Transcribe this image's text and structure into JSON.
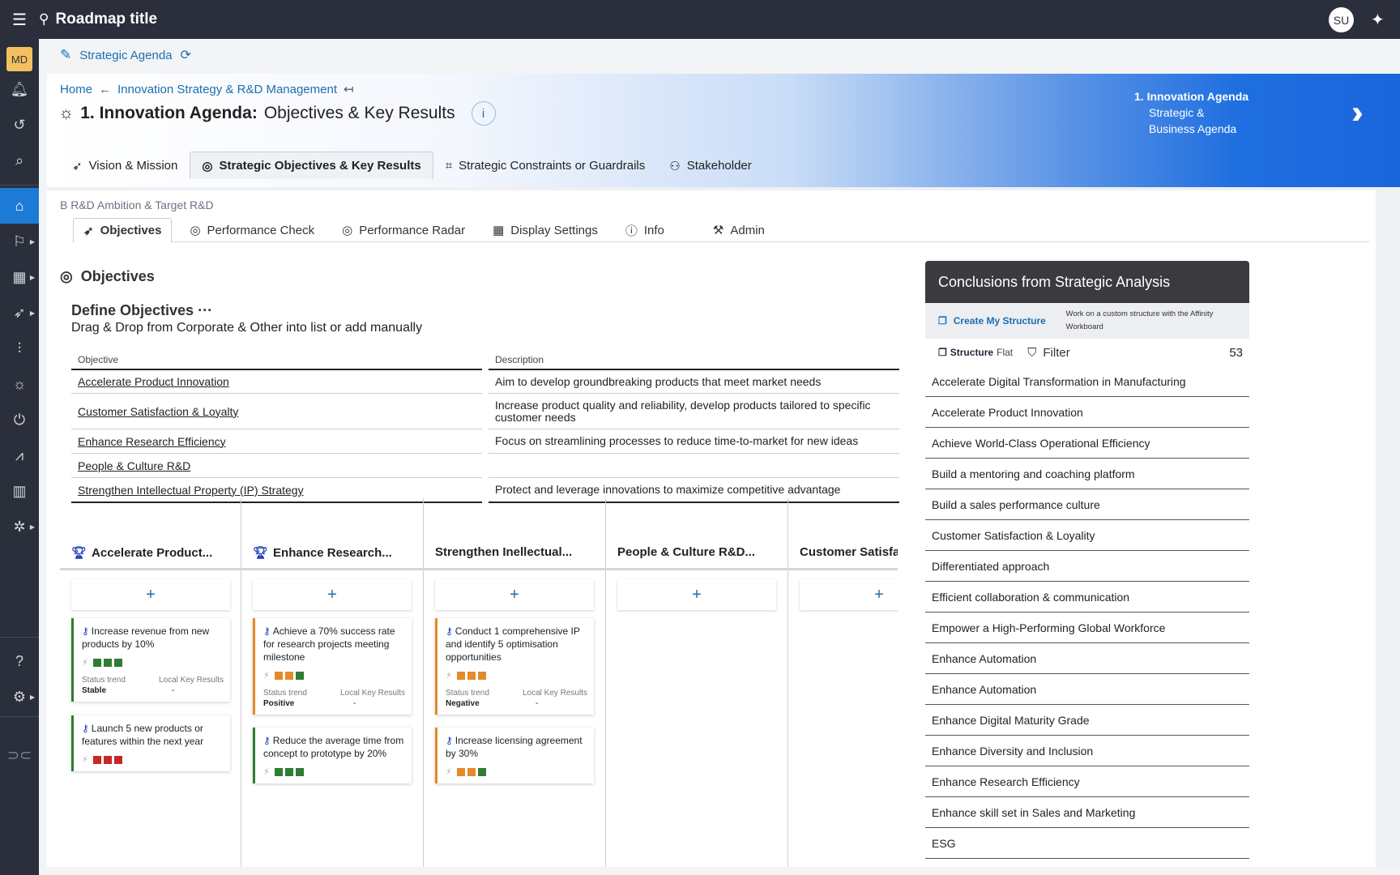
{
  "topbar": {
    "title": "Roadmap title",
    "user_initials": "SU"
  },
  "rail": {
    "workspace_badge": "MD"
  },
  "workspace": {
    "label": "Strategic Agenda"
  },
  "breadcrumb": {
    "home": "Home",
    "parent": "Innovation Strategy & R&D Management"
  },
  "page": {
    "title_bold": "1. Innovation Agenda:",
    "title_rest": "Objectives & Key Results"
  },
  "next_step": {
    "title": "1. Innovation Agenda",
    "sub1": "Strategic &",
    "sub2": "Business Agenda"
  },
  "tabs": [
    {
      "label": "Vision & Mission",
      "icon": "rocket-icon"
    },
    {
      "label": "Strategic Objectives & Key Results",
      "icon": "target-icon",
      "active": true
    },
    {
      "label": "Strategic Constraints or Guardrails",
      "icon": "frame-icon"
    },
    {
      "label": "Stakeholder",
      "icon": "people-icon"
    }
  ],
  "section_label": "B R&D Ambition & Target R&D",
  "subtabs": [
    {
      "label": "Objectives",
      "active": true
    },
    {
      "label": "Performance Check"
    },
    {
      "label": "Performance Radar"
    },
    {
      "label": "Display Settings"
    },
    {
      "label": "Info"
    },
    {
      "label": "Admin"
    }
  ],
  "objectives": {
    "heading": "Objectives",
    "define_title": "Define Objectives",
    "define_more": "···",
    "define_sub": "Drag & Drop from Corporate & Other into list or add manually",
    "col_objective": "Objective",
    "col_description": "Description",
    "rows": [
      {
        "objective": "Accelerate Product Innovation",
        "description": "Aim to develop groundbreaking products that meet market needs"
      },
      {
        "objective": "Customer Satisfaction & Loyalty",
        "description": "Increase product quality and reliability, develop products tailored to specific customer needs"
      },
      {
        "objective": "Enhance Research Efficiency",
        "description": "Focus on streamlining processes to reduce time-to-market for new ideas"
      },
      {
        "objective": "People & Culture R&D",
        "description": ""
      },
      {
        "objective": "Strengthen Intellectual Property (IP) Strategy",
        "description": "Protect and leverage innovations to maximize competitive advantage"
      }
    ]
  },
  "kanban": {
    "add_label": "+",
    "status_label": "Status trend",
    "local_label": "Local Key Results",
    "columns": [
      {
        "title": "Accelerate Product...",
        "trophy": true
      },
      {
        "title": "Enhance Research...",
        "trophy": true
      },
      {
        "title": "Strengthen Inellectual...",
        "trophy": false
      },
      {
        "title": "People & Culture R&D...",
        "trophy": false
      },
      {
        "title": "Customer Satisfa",
        "trophy": false
      }
    ],
    "cards": [
      {
        "text": "Increase revenue from new products by 10%",
        "status": "Stable",
        "local": "-",
        "colors": [
          "#2e7d32",
          "#2e7d32",
          "#2e7d32"
        ]
      },
      {
        "text": "Launch 5 new products or features within the next year",
        "status": "",
        "local": "",
        "colors": [
          "#c62828",
          "#c62828",
          "#c62828"
        ]
      },
      {
        "text": "Achieve a 70% success rate for research projects meeting milestone",
        "status": "Positive",
        "local": "-",
        "colors": [
          "#e6892b",
          "#e6892b",
          "#2e7d32"
        ]
      },
      {
        "text": "Reduce the average time from concept to prototype by 20%",
        "status": "",
        "local": "",
        "colors": [
          "#2e7d32",
          "#2e7d32",
          "#2e7d32"
        ]
      },
      {
        "text": "Conduct 1 comprehensive IP and identify 5 optimisation opportunities",
        "status": "Negative",
        "local": "-",
        "colors": [
          "#e6892b",
          "#e6892b",
          "#e6892b"
        ]
      },
      {
        "text": "Increase licensing agreement by 30%",
        "status": "",
        "local": "",
        "colors": [
          "#e6892b",
          "#e6892b",
          "#2e7d32"
        ]
      }
    ]
  },
  "conclusions": {
    "title": "Conclusions from Strategic Analysis",
    "create_label": "Create My Structure",
    "create_desc": "Work on a custom structure with the Affinity Workboard",
    "structure_label": "Structure",
    "structure_mode": "Flat",
    "filter_label": "Filter",
    "count": "53",
    "items": [
      "Accelerate Digital Transformation in Manufacturing",
      "Accelerate Product Innovation",
      "Achieve World-Class Operational Efficiency",
      "Build a mentoring and coaching platform",
      "Build a sales performance culture",
      "Customer Satisfaction & Loyality",
      "Differentiated approach",
      "Efficient collaboration & communication",
      "Empower a High-Performing Global Workforce",
      "Enhance Automation",
      "Enhance Automation",
      "Enhance Digital Maturity Grade",
      "Enhance Diversity and Inclusion",
      "Enhance Research Efficiency",
      "Enhance skill set in Sales and Marketing",
      "ESG"
    ]
  }
}
